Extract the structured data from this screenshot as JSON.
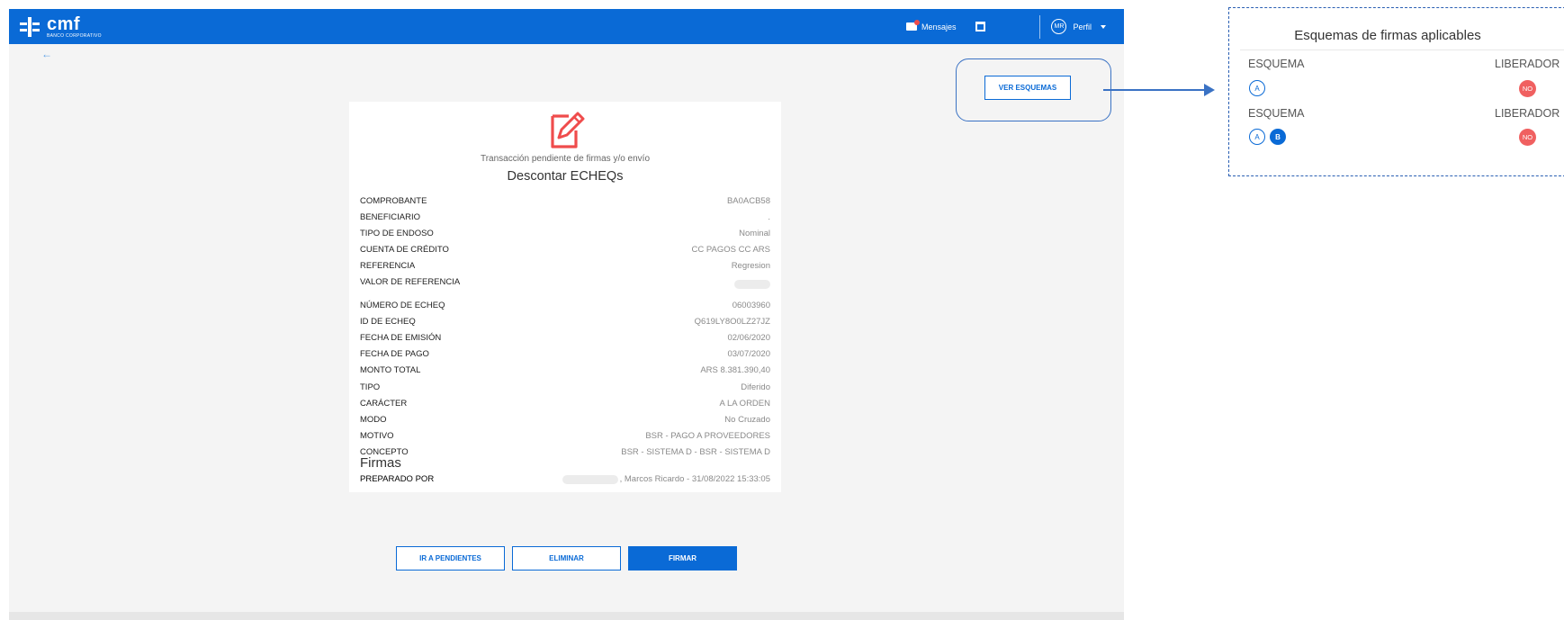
{
  "header": {
    "logo_name": "cmf",
    "logo_sub": "BANCO CORPORATIVO",
    "messages_label": "Mensajes",
    "avatar_initials": "MR",
    "profile_label": "Perfil"
  },
  "back_icon": "←",
  "ver_esquemas_label": "VER ESQUEMAS",
  "card": {
    "status": "Transacción pendiente de firmas y/o envío",
    "title": "Descontar ECHEQs",
    "rows_a": [
      {
        "label": "COMPROBANTE",
        "value": "BA0ACB58"
      },
      {
        "label": "BENEFICIARIO",
        "value": "."
      },
      {
        "label": "TIPO DE ENDOSO",
        "value": "Nominal"
      },
      {
        "label": "CUENTA DE CRÉDITO",
        "value": "CC PAGOS CC ARS"
      },
      {
        "label": "REFERENCIA",
        "value": "Regresion"
      },
      {
        "label": "VALOR DE REFERENCIA",
        "value": ""
      }
    ],
    "rows_b": [
      {
        "label": "NÚMERO DE ECHEQ",
        "value": "06003960"
      },
      {
        "label": "ID DE ECHEQ",
        "value": "Q619LY8O0LZ27JZ"
      },
      {
        "label": "FECHA DE EMISIÓN",
        "value": "02/06/2020"
      },
      {
        "label": "FECHA DE PAGO",
        "value": "03/07/2020"
      },
      {
        "label": "MONTO TOTAL",
        "value": "ARS 8.381.390,40"
      },
      {
        "label": "TIPO",
        "value": "Diferido"
      },
      {
        "label": "CARÁCTER",
        "value": "A LA ORDEN"
      },
      {
        "label": "MODO",
        "value": "No Cruzado"
      },
      {
        "label": "MOTIVO",
        "value": "BSR - PAGO A PROVEEDORES"
      },
      {
        "label": "CONCEPTO",
        "value": "BSR - SISTEMA D - BSR - SISTEMA D"
      }
    ],
    "firmas_title": "Firmas",
    "preparado_label": "PREPARADO POR",
    "preparado_value": ", Marcos Ricardo - 31/08/2022 15:33:05"
  },
  "actions": {
    "ir_pendientes": "IR A PENDIENTES",
    "eliminar": "ELIMINAR",
    "firmar": "FIRMAR"
  },
  "panel": {
    "title": "Esquemas de firmas aplicables",
    "esquema_label": "ESQUEMA",
    "liberador_label": "LIBERADOR",
    "schema1": {
      "badges": [
        "A"
      ],
      "liberador": "NO"
    },
    "schema2": {
      "badges": [
        "A",
        "B"
      ],
      "liberador": "NO"
    }
  },
  "colors": {
    "primary": "#0a6ad6",
    "danger": "#f06060",
    "annotation": "#3a72c4"
  }
}
